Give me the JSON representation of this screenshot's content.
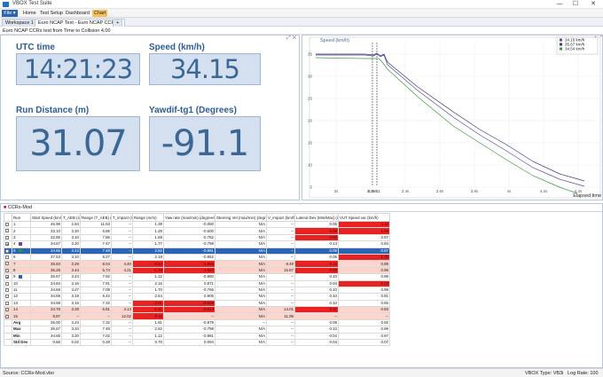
{
  "window": {
    "title": "VBOX Test Suite",
    "min": "—",
    "max": "☐",
    "close": "✕"
  },
  "menu": {
    "file": "File ▾",
    "items": [
      "Home",
      "Test Setup",
      "Dashboard"
    ],
    "chart": "Chart"
  },
  "tabs": {
    "workspace": "Workspace 1",
    "ncap": "Euro NCAP Test - Euro NCAP CCRs 1",
    "add": "+"
  },
  "info": "Euro NCAP CCRs test from Time to Collision 4.00",
  "values": {
    "utc": {
      "label": "UTC time",
      "value": "14:21:23"
    },
    "speed": {
      "label": "Speed (km/h)",
      "value": "34.15"
    },
    "distance": {
      "label": "Run Distance (m)",
      "value": "31.07"
    },
    "yaw": {
      "label": "Yawdif-tg1 (Degrees)",
      "value": "-91.1"
    }
  },
  "graph": {
    "ylabel": "Speed (km/h)",
    "xlabel": "Elapsed time",
    "yticks": [
      "35",
      "30",
      "25",
      "20",
      "15",
      "10",
      "5"
    ],
    "xticks": [
      "3s",
      "3.2s",
      "3.4s",
      "3.6s",
      "3.8s",
      "4s",
      "4.2s",
      "4.4s"
    ],
    "cursor_label": "4.1851",
    "legend": [
      {
        "label": "34.15 km/h",
        "color": "#5b4aa0"
      },
      {
        "label": "35.67 km/h",
        "color": "#3a3a7a"
      },
      {
        "label": "34.54 km/h",
        "color": "#3a9a3a"
      }
    ]
  },
  "table": {
    "panel_title": "CCRs-Mod",
    "headers": [
      "",
      "Run",
      "Start Speed (km/h)",
      "T_AEB (s)",
      "Range (T_AEB) (m)",
      "T_impact (s)",
      "Range (m/m)",
      "Yaw rate (max/min) (degree/s)",
      "Steering Vel (max/min) (degree/s)",
      "V_impact (km/h)",
      "Lateral Dev (Min/Max) (m)",
      "VUT Speed var (km/h)"
    ],
    "rows": [
      {
        "cls": "",
        "cb": "",
        "sw": "",
        "cells": [
          "1",
          "45.99",
          "2.84",
          "11.53",
          "--",
          "1.39",
          "-0.050",
          "N/A",
          "--",
          "0.06",
          "1.11"
        ],
        "red": [
          10
        ]
      },
      {
        "cls": "",
        "cb": "",
        "sw": "",
        "cells": [
          "2",
          "33.10",
          "3.20",
          "6.85",
          "--",
          "1.28",
          "-0.600",
          "N/A",
          "--",
          "0.09",
          "1.09"
        ],
        "red": [
          9,
          10
        ]
      },
      {
        "cls": "",
        "cb": "",
        "sw": "",
        "cells": [
          "3",
          "32.85",
          "3.10",
          "7.86",
          "--",
          "1.69",
          "-0.782",
          "N/A",
          "--",
          "0.06",
          "0.97"
        ],
        "red": [
          9
        ]
      },
      {
        "cls": "",
        "cb": "✔",
        "sw": "#7b3fa0",
        "cells": [
          "4",
          "34.67",
          "3.20",
          "7.47",
          "--",
          "1.77",
          "-0.798",
          "N/A",
          "--",
          "0.14",
          "0.84"
        ],
        "red": []
      },
      {
        "cls": "sel",
        "cb": "✔",
        "sw": "#2a9a2a",
        "cells": [
          "5",
          "34.65",
          "3.23",
          "7.48",
          "--",
          "2.52",
          "-0.981",
          "N/A",
          "--",
          "0.09",
          "0.87"
        ],
        "red": []
      },
      {
        "cls": "",
        "cb": "",
        "sw": "",
        "cells": [
          "6",
          "37.53",
          "3.10",
          "8.27",
          "--",
          "2.19",
          "-0.952",
          "N/A",
          "--",
          "0.05",
          "1.35"
        ],
        "red": [
          10
        ]
      },
      {
        "cls": "pink",
        "cb": "",
        "sw": "",
        "cells": [
          "7",
          "35.63",
          "3.29",
          "8.04",
          "4.40",
          "-0.54",
          "-1.558",
          "N/A",
          "8.49",
          "0.12",
          "0.89"
        ],
        "red": [
          5,
          6,
          9
        ]
      },
      {
        "cls": "pink",
        "cb": "",
        "sw": "",
        "cells": [
          "8",
          "36.28",
          "3.44",
          "5.74",
          "4.21",
          "-1.18",
          "-1.637",
          "N/A",
          "15.87",
          "0.09",
          "0.99"
        ],
        "red": [
          5,
          6,
          9
        ]
      },
      {
        "cls": "",
        "cb": "✔",
        "sw": "#2b5fb5",
        "cells": [
          "9",
          "35.67",
          "3.24",
          "7.92",
          "--",
          "1.12",
          "-0.850",
          "N/A",
          "--",
          "0.10",
          "0.99"
        ],
        "red": []
      },
      {
        "cls": "",
        "cb": "",
        "sw": "",
        "cells": [
          "10",
          "34.84",
          "3.16",
          "7.91",
          "--",
          "2.15",
          "0.871",
          "N/A",
          "--",
          "0.04",
          "1.13"
        ],
        "red": [
          10
        ]
      },
      {
        "cls": "",
        "cb": "",
        "sw": "",
        "cells": [
          "11",
          "34.68",
          "3.27",
          "7.09",
          "--",
          "1.70",
          "-0.766",
          "N/A",
          "--",
          "0.10",
          "0.98"
        ],
        "red": []
      },
      {
        "cls": "",
        "cb": "",
        "sw": "",
        "cells": [
          "12",
          "34.69",
          "3.19",
          "6.42",
          "--",
          "2.54",
          "0.905",
          "N/A",
          "--",
          "0.10",
          "0.81"
        ],
        "red": []
      },
      {
        "cls": "",
        "cb": "",
        "sw": "",
        "cells": [
          "13",
          "34.68",
          "3.15",
          "7.32",
          "--",
          "2.01",
          "-0.926",
          "N/A",
          "--",
          "0.10",
          "0.65"
        ],
        "red": [
          5,
          6
        ]
      },
      {
        "cls": "pink",
        "cb": "",
        "sw": "",
        "cells": [
          "14",
          "34.78",
          "3.28",
          "6.81",
          "4.13",
          "-1.21",
          "-0.813",
          "N/A",
          "14.01",
          "0.11",
          "0.93"
        ],
        "red": [
          5,
          6,
          9
        ]
      },
      {
        "cls": "pink",
        "cb": "",
        "sw": "",
        "cells": [
          "15",
          "8.87",
          "--",
          "--",
          "12.02",
          "-0.11",
          "--",
          "N/A",
          "11.09",
          "--",
          "--"
        ],
        "red": [
          5
        ]
      }
    ],
    "stats": [
      [
        "Avg",
        "35.00",
        "3.23",
        "7.32",
        "--",
        "1.81",
        "-0.879",
        "--",
        "--",
        "0.08",
        "0.92"
      ],
      [
        "Max",
        "35.67",
        "3.34",
        "7.48",
        "--",
        "2.52",
        "-0.798",
        "N/A",
        "--",
        "0.10",
        "0.99"
      ],
      [
        "Min",
        "34.65",
        "3.20",
        "7.02",
        "--",
        "1.12",
        "-0.981",
        "N/A",
        "--",
        "0.04",
        "0.87"
      ],
      [
        "Std Dev",
        "0.58",
        "0.02",
        "0.28",
        "--",
        "0.70",
        "0.094",
        "N/A",
        "--",
        "0.04",
        "0.07"
      ]
    ]
  },
  "status": {
    "left": "Source: CCRs-Mod.vbo",
    "type": "VBOX Type: VB3i",
    "rate": "Log Rate: 100"
  }
}
